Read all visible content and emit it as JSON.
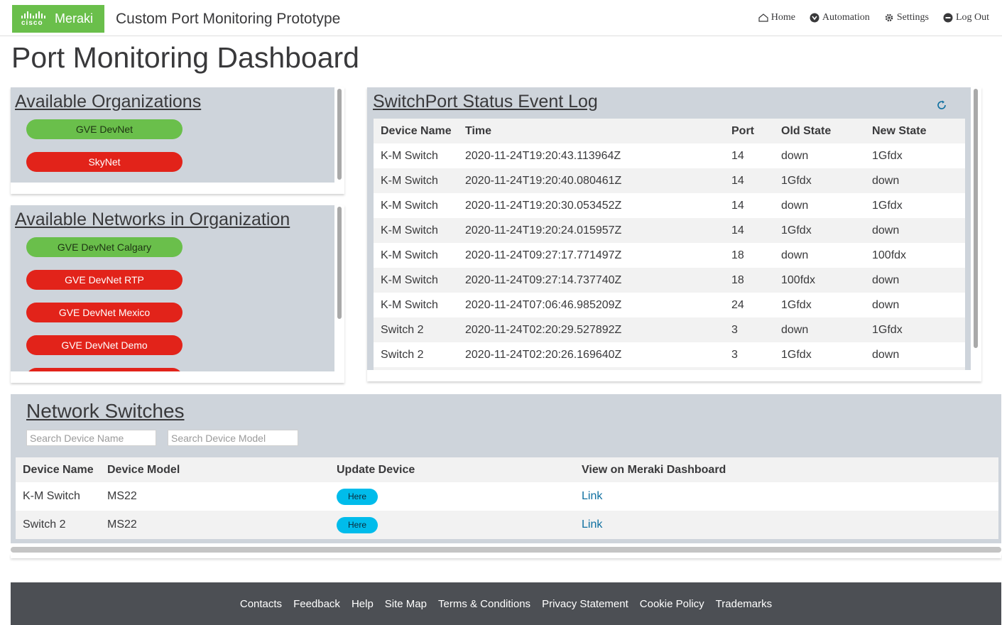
{
  "header": {
    "logo_cisco": "cisco",
    "logo_meraki": "Meraki",
    "app_title": "Custom Port Monitoring Prototype",
    "nav": [
      {
        "label": "Home",
        "icon": "home-icon"
      },
      {
        "label": "Automation",
        "icon": "automation-icon"
      },
      {
        "label": "Settings",
        "icon": "gear-icon"
      },
      {
        "label": "Log Out",
        "icon": "logout-icon"
      }
    ]
  },
  "page_title": "Port Monitoring Dashboard",
  "organizations": {
    "title": "Available Organizations",
    "items": [
      {
        "label": "GVE DevNet",
        "status": "green"
      },
      {
        "label": "SkyNet",
        "status": "red"
      }
    ]
  },
  "networks": {
    "title": "Available Networks in Organization",
    "items": [
      {
        "label": "GVE DevNet Calgary",
        "status": "green"
      },
      {
        "label": "GVE DevNet RTP",
        "status": "red"
      },
      {
        "label": "GVE DevNet Mexico",
        "status": "red"
      },
      {
        "label": "GVE DevNet Demo",
        "status": "red"
      }
    ]
  },
  "event_log": {
    "title": "SwitchPort Status Event Log",
    "refresh_icon": "refresh-icon",
    "columns": [
      "Device Name",
      "Time",
      "Port",
      "Old State",
      "New State"
    ],
    "rows": [
      [
        "K-M Switch",
        "2020-11-24T19:20:43.113964Z",
        "14",
        "down",
        "1Gfdx"
      ],
      [
        "K-M Switch",
        "2020-11-24T19:20:40.080461Z",
        "14",
        "1Gfdx",
        "down"
      ],
      [
        "K-M Switch",
        "2020-11-24T19:20:30.053452Z",
        "14",
        "down",
        "1Gfdx"
      ],
      [
        "K-M Switch",
        "2020-11-24T19:20:24.015957Z",
        "14",
        "1Gfdx",
        "down"
      ],
      [
        "K-M Switch",
        "2020-11-24T09:27:17.771497Z",
        "18",
        "down",
        "100fdx"
      ],
      [
        "K-M Switch",
        "2020-11-24T09:27:14.737740Z",
        "18",
        "100fdx",
        "down"
      ],
      [
        "K-M Switch",
        "2020-11-24T07:06:46.985209Z",
        "24",
        "1Gfdx",
        "down"
      ],
      [
        "Switch 2",
        "2020-11-24T02:20:29.527892Z",
        "3",
        "down",
        "1Gfdx"
      ],
      [
        "Switch 2",
        "2020-11-24T02:20:26.169640Z",
        "3",
        "1Gfdx",
        "down"
      ]
    ]
  },
  "switches": {
    "title": "Network Switches",
    "search_name_placeholder": "Search Device Name",
    "search_model_placeholder": "Search Device Model",
    "columns": [
      "Device Name",
      "Device Model",
      "Update Device",
      "View on Meraki Dashboard"
    ],
    "rows": [
      {
        "name": "K-M Switch",
        "model": "MS22",
        "update_label": "Here",
        "link_label": "Link"
      },
      {
        "name": "Switch 2",
        "model": "MS22",
        "update_label": "Here",
        "link_label": "Link"
      }
    ]
  },
  "footer": {
    "links": [
      "Contacts",
      "Feedback",
      "Help",
      "Site Map",
      "Terms & Conditions",
      "Privacy Statement",
      "Cookie Policy",
      "Trademarks"
    ]
  },
  "colors": {
    "green": "#6abf4b",
    "red": "#e2231a",
    "panel": "#ced4db",
    "accent_button": "#00bceb",
    "footer": "#4c4f54"
  }
}
